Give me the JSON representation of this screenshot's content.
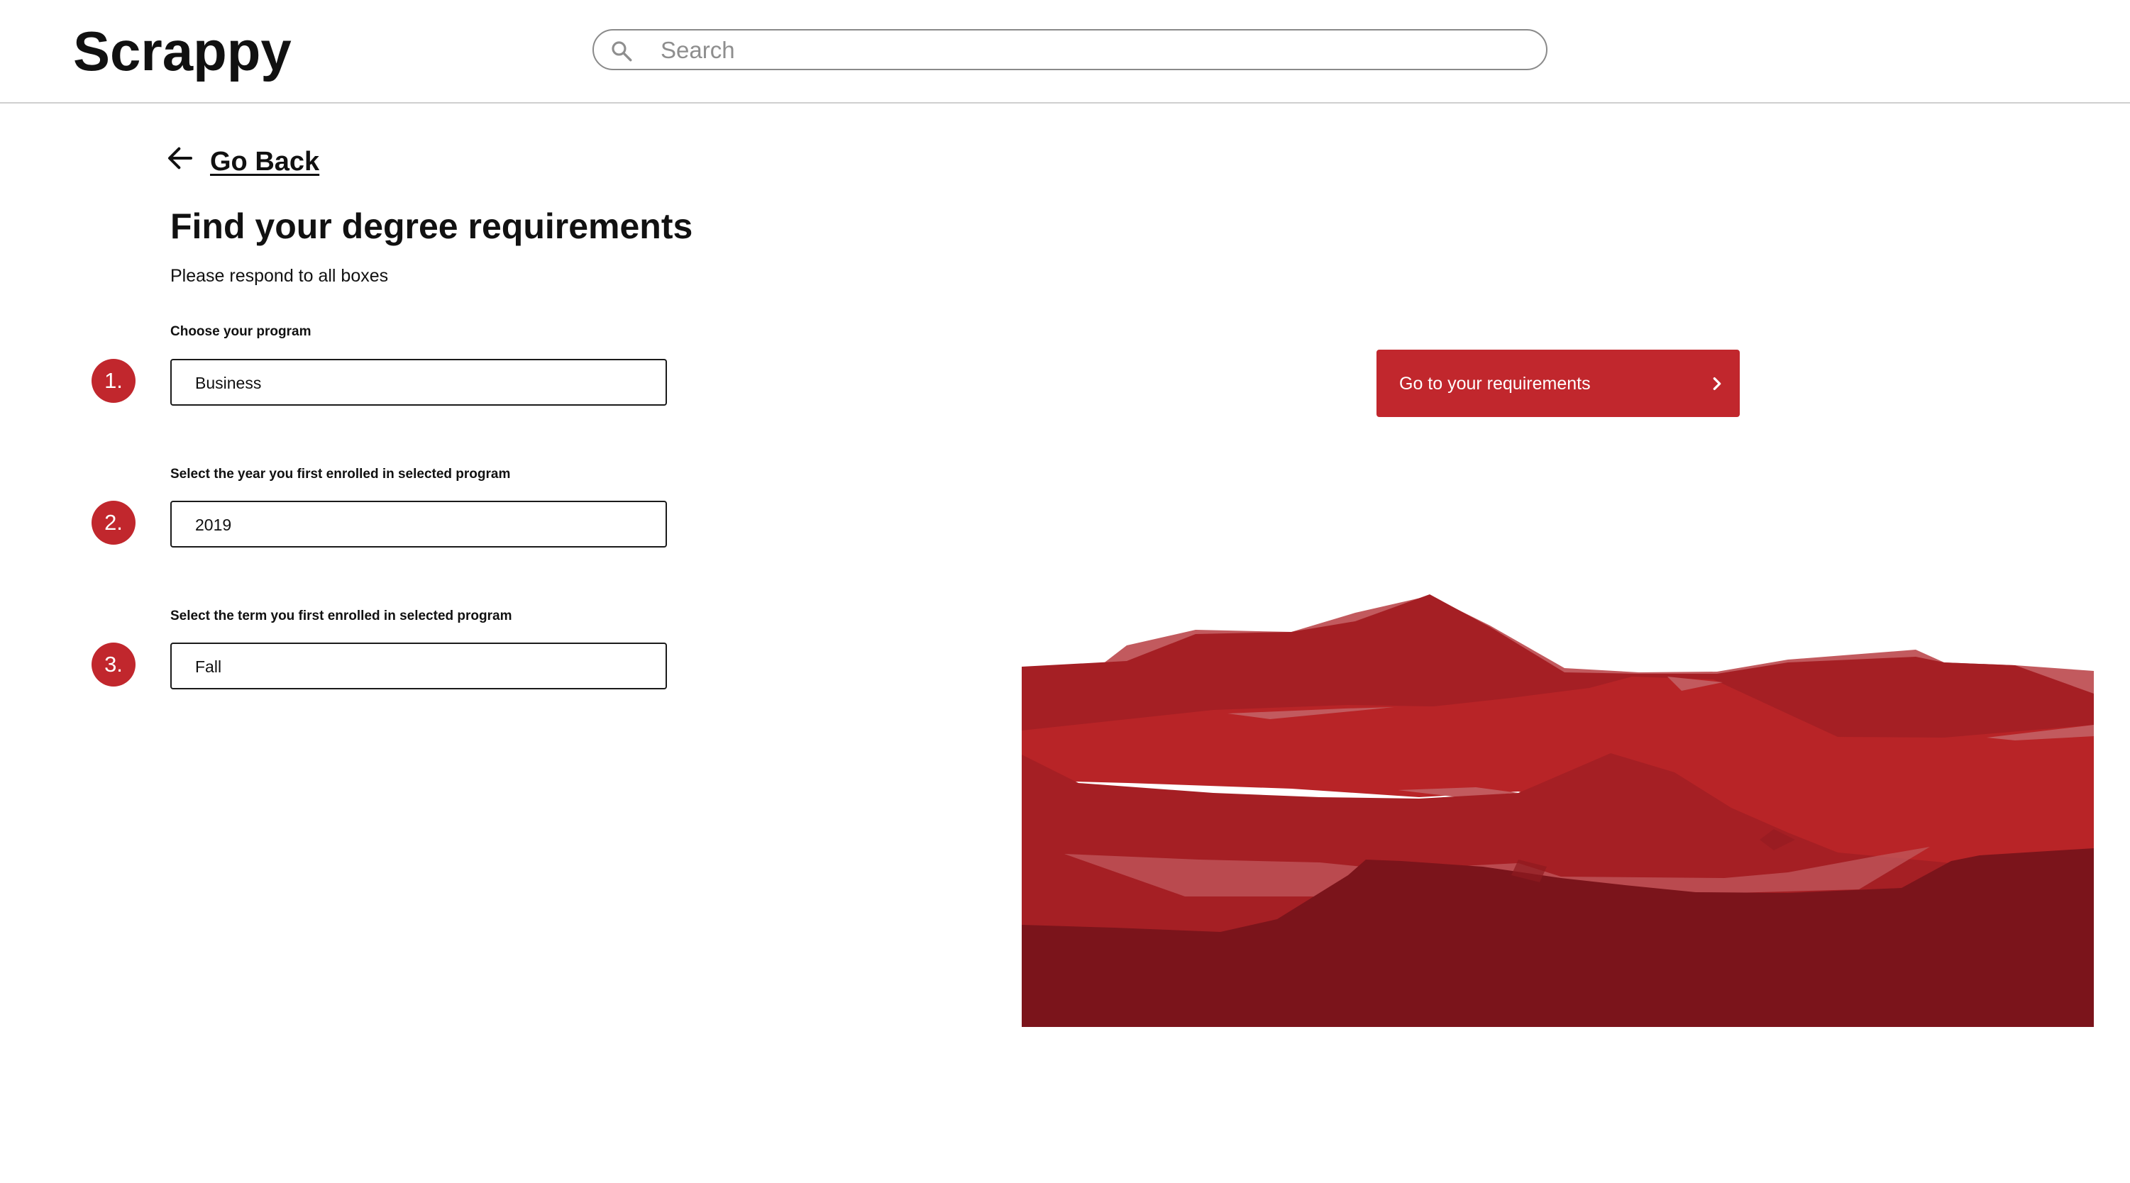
{
  "header": {
    "logo": "Scrappy",
    "search": {
      "placeholder": "Search",
      "value": ""
    }
  },
  "nav": {
    "back_label": "Go Back"
  },
  "form": {
    "title": "Find your degree requirements",
    "subtitle": "Please respond to all boxes",
    "steps": [
      {
        "number": "1.",
        "label": "Choose your program",
        "value": "Business"
      },
      {
        "number": "2.",
        "label": "Select the year you first enrolled in selected program",
        "value": "2019"
      },
      {
        "number": "3.",
        "label": "Select the term you first enrolled in selected program",
        "value": "Fall"
      }
    ]
  },
  "cta": {
    "label": "Go to your requirements"
  },
  "icons": {
    "search": "search-icon",
    "back": "arrow-left-icon",
    "cta": "chevron-right-icon"
  },
  "colors": {
    "accent": "#c1272d",
    "mountain_light": "#c25a5e",
    "mountain_mid": "#a51f24",
    "mountain_bright": "#b82427",
    "mountain_dark": "#7b141b"
  }
}
